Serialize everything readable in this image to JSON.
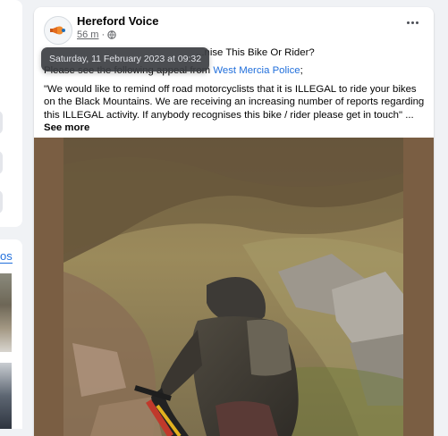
{
  "left_sidebar": {
    "link_text": "os"
  },
  "post": {
    "author": "Hereford Voice",
    "time": "56 m",
    "separator": "·",
    "tooltip": "Saturday, 11 February 2023 at 09:32",
    "title_text": "...nise This Bike Or Rider?",
    "appeal_prefix": "Please see the following appeal from ",
    "appeal_link": "West Mercia Police",
    "appeal_suffix": ";",
    "quote": "\"We would like to remind off road motorcyclists that it is ILLEGAL to ride your bikes on the Black Mountains.  We are receiving an increasing number of reports regarding this ILLEGAL activity.  If anybody recognises this bike / rider please get in touch\" ...",
    "see_more": "See more",
    "icons": {
      "avatar": "hereford-voice-logo",
      "privacy": "globe-icon",
      "menu": "more-options-icon"
    },
    "photo_description_icon": "photo"
  },
  "colors": {
    "link": "#216fdb",
    "background": "#f0f2f5",
    "tooltip_bg": "#3c3e42"
  }
}
